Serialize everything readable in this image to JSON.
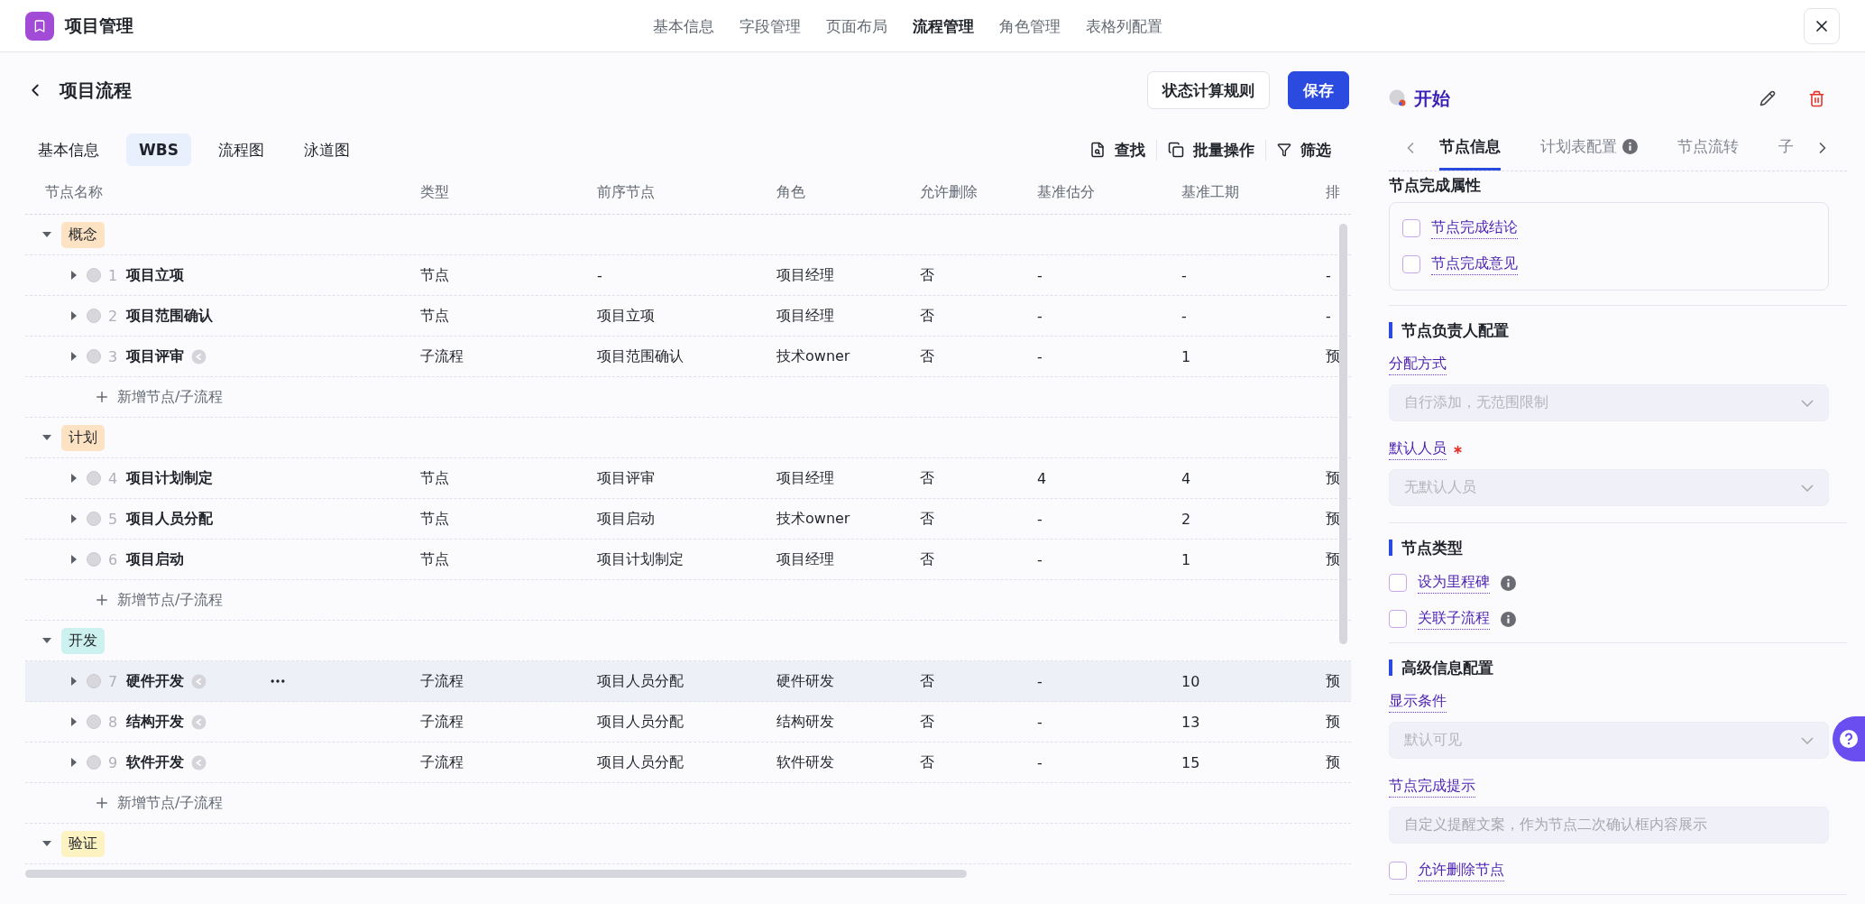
{
  "app": {
    "title": "项目管理"
  },
  "nav": [
    {
      "label": "基本信息",
      "selected": false
    },
    {
      "label": "字段管理",
      "selected": false
    },
    {
      "label": "页面布局",
      "selected": false
    },
    {
      "label": "流程管理",
      "selected": true
    },
    {
      "label": "角色管理",
      "selected": false
    },
    {
      "label": "表格列配置",
      "selected": false
    }
  ],
  "page": {
    "title": "项目流程",
    "buttons": [
      {
        "label": "状态计算规则",
        "kind": "secondary"
      },
      {
        "label": "保存",
        "kind": "primary"
      }
    ]
  },
  "view_tabs": [
    {
      "label": "基本信息",
      "selected": false
    },
    {
      "label": "WBS",
      "selected": true
    },
    {
      "label": "流程图",
      "selected": false
    },
    {
      "label": "泳道图",
      "selected": false
    }
  ],
  "toolbar": [
    {
      "label": "查找",
      "kind": "find"
    },
    {
      "label": "批量操作",
      "kind": "batch"
    },
    {
      "label": "筛选",
      "kind": "filter"
    }
  ],
  "table": {
    "columns": [
      "节点名称",
      "类型",
      "前序节点",
      "角色",
      "允许删除",
      "基准估分",
      "基准工期",
      "排"
    ],
    "groups": [
      {
        "label": "概念",
        "color": "#fde3c4",
        "expanded": true,
        "add_label": "新增节点/子流程",
        "rows": [
          {
            "index": "1",
            "name": "项目立项",
            "subflow": false,
            "expanded": false,
            "hovered": false,
            "cells": [
              "节点",
              "-",
              "项目经理",
              "否",
              "-",
              "-",
              "-"
            ]
          },
          {
            "index": "2",
            "name": "项目范围确认",
            "subflow": false,
            "expanded": false,
            "hovered": false,
            "cells": [
              "节点",
              "项目立项",
              "项目经理",
              "否",
              "-",
              "-",
              "-"
            ]
          },
          {
            "index": "3",
            "name": "项目评审",
            "subflow": true,
            "expanded": false,
            "hovered": false,
            "cells": [
              "子流程",
              "项目范围确认",
              "技术owner",
              "否",
              "-",
              "1",
              "预"
            ]
          }
        ]
      },
      {
        "label": "计划",
        "color": "#fde3c4",
        "expanded": true,
        "add_label": "新增节点/子流程",
        "rows": [
          {
            "index": "4",
            "name": "项目计划制定",
            "subflow": false,
            "expanded": false,
            "hovered": false,
            "cells": [
              "节点",
              "项目评审",
              "项目经理",
              "否",
              "4",
              "4",
              "预"
            ]
          },
          {
            "index": "5",
            "name": "项目人员分配",
            "subflow": false,
            "expanded": false,
            "hovered": false,
            "cells": [
              "节点",
              "项目启动",
              "技术owner",
              "否",
              "-",
              "2",
              "预"
            ]
          },
          {
            "index": "6",
            "name": "项目启动",
            "subflow": false,
            "expanded": false,
            "hovered": false,
            "cells": [
              "节点",
              "项目计划制定",
              "项目经理",
              "否",
              "-",
              "1",
              "预"
            ]
          }
        ]
      },
      {
        "label": "开发",
        "color": "#cdf1ee",
        "expanded": true,
        "add_label": "新增节点/子流程",
        "rows": [
          {
            "index": "7",
            "name": "硬件开发",
            "subflow": true,
            "expanded": false,
            "hovered": true,
            "cells": [
              "子流程",
              "项目人员分配",
              "硬件研发",
              "否",
              "-",
              "10",
              "预"
            ]
          },
          {
            "index": "8",
            "name": "结构开发",
            "subflow": true,
            "expanded": false,
            "hovered": false,
            "cells": [
              "子流程",
              "项目人员分配",
              "结构研发",
              "否",
              "-",
              "13",
              "预"
            ]
          },
          {
            "index": "9",
            "name": "软件开发",
            "subflow": true,
            "expanded": false,
            "hovered": false,
            "cells": [
              "子流程",
              "项目人员分配",
              "软件研发",
              "否",
              "-",
              "15",
              "预"
            ]
          }
        ]
      },
      {
        "label": "验证",
        "color": "#fdf2c2",
        "expanded": true
      }
    ]
  },
  "node_panel": {
    "title": "开始",
    "tabs": [
      {
        "label": "节点信息",
        "selected": true,
        "info": false
      },
      {
        "label": "计划表配置",
        "selected": false,
        "info": true
      },
      {
        "label": "节点流转",
        "selected": false,
        "info": false
      },
      {
        "label": "子",
        "selected": false,
        "info": false
      }
    ],
    "sections": [
      {
        "title": "节点完成属性",
        "kind": "card",
        "items": [
          {
            "kind": "checkbox",
            "label": "节点完成结论",
            "checked": false,
            "info": false
          },
          {
            "kind": "checkbox",
            "label": "节点完成意见",
            "checked": false,
            "info": false
          }
        ]
      },
      {
        "title": "节点负责人配置",
        "kind": "marked",
        "items": [
          {
            "kind": "select",
            "label": "分配方式",
            "value": "自行添加，无范围限制",
            "required": false,
            "disabled": true
          },
          {
            "kind": "select",
            "label": "默认人员",
            "value": "无默认人员",
            "required": true,
            "disabled": true
          }
        ]
      },
      {
        "title": "节点类型",
        "kind": "marked",
        "items": [
          {
            "kind": "checkbox",
            "label": "设为里程碑",
            "checked": false,
            "info": true
          },
          {
            "kind": "checkbox",
            "label": "关联子流程",
            "checked": false,
            "info": true
          }
        ]
      },
      {
        "title": "高级信息配置",
        "kind": "marked",
        "items": [
          {
            "kind": "select",
            "label": "显示条件",
            "value": "默认可见",
            "required": false,
            "disabled": true
          },
          {
            "kind": "textarea",
            "label": "节点完成提示",
            "placeholder": "自定义提醒文案，作为节点二次确认框内容展示"
          },
          {
            "kind": "checkbox",
            "label": "允许删除节点",
            "checked": false,
            "info": false
          }
        ]
      }
    ]
  }
}
